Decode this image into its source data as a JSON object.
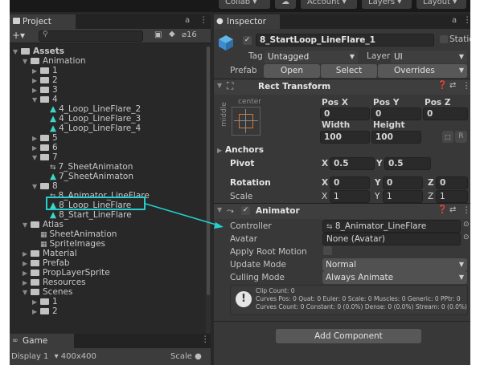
{
  "toolbar": {
    "collab": "Collab",
    "account": "Account",
    "layers": "Layers",
    "layout": "Layout"
  },
  "project": {
    "tab": "Project",
    "hidden_count": "16",
    "tree": [
      {
        "label": "Assets",
        "kind": "folder-open",
        "depth": 0,
        "bold": true
      },
      {
        "label": "Animation",
        "kind": "folder-open",
        "depth": 1
      },
      {
        "label": "1",
        "kind": "folder",
        "depth": 2
      },
      {
        "label": "2",
        "kind": "folder",
        "depth": 2
      },
      {
        "label": "3",
        "kind": "folder",
        "depth": 2
      },
      {
        "label": "4",
        "kind": "folder-open",
        "depth": 2
      },
      {
        "label": "4_Loop_LineFlare_2",
        "kind": "sprite",
        "depth": 3
      },
      {
        "label": "4_Loop_LineFlare_3",
        "kind": "sprite",
        "depth": 3
      },
      {
        "label": "4_Loop_LineFlare_4",
        "kind": "sprite",
        "depth": 3
      },
      {
        "label": "5",
        "kind": "folder",
        "depth": 2
      },
      {
        "label": "6",
        "kind": "folder",
        "depth": 2
      },
      {
        "label": "7",
        "kind": "folder-open",
        "depth": 2
      },
      {
        "label": "7_SheetAnimaton",
        "kind": "animator",
        "depth": 3
      },
      {
        "label": "7_SheetAnimaton",
        "kind": "sprite",
        "depth": 3
      },
      {
        "label": "8",
        "kind": "folder-open",
        "depth": 2
      },
      {
        "label": "8_Animator_LineFlare",
        "kind": "animator",
        "depth": 3
      },
      {
        "label": "8_Loop_LineFlare",
        "kind": "sprite",
        "depth": 3
      },
      {
        "label": "8_Start_LineFlare",
        "kind": "sprite",
        "depth": 3
      },
      {
        "label": "Atlas",
        "kind": "folder-open",
        "depth": 1
      },
      {
        "label": "SheetAnimation",
        "kind": "atlas",
        "depth": 2
      },
      {
        "label": "SpriteImages",
        "kind": "atlas",
        "depth": 2
      },
      {
        "label": "Material",
        "kind": "folder",
        "depth": 1
      },
      {
        "label": "Prefab",
        "kind": "folder",
        "depth": 1
      },
      {
        "label": "PropLayerSprite",
        "kind": "folder",
        "depth": 1
      },
      {
        "label": "Resources",
        "kind": "folder",
        "depth": 1
      },
      {
        "label": "Scenes",
        "kind": "folder-open",
        "depth": 1
      },
      {
        "label": "1",
        "kind": "folder",
        "depth": 2
      },
      {
        "label": "2",
        "kind": "folder",
        "depth": 2
      }
    ]
  },
  "game": {
    "tab": "Game",
    "display": "Display 1",
    "resolution": "400x400",
    "scale": "Scale"
  },
  "inspector": {
    "tab": "Inspector",
    "object_name": "8_StartLoop_LineFlare_1",
    "static": "Static",
    "tag_label": "Tag",
    "tag_value": "Untagged",
    "layer_label": "Layer",
    "layer_value": "UI",
    "prefab_label": "Prefab",
    "prefab_open": "Open",
    "prefab_select": "Select",
    "prefab_overrides": "Overrides",
    "rect_transform": {
      "title": "Rect Transform",
      "anchor_h": "center",
      "anchor_v": "middle",
      "pos_x_label": "Pos X",
      "pos_y_label": "Pos Y",
      "pos_z_label": "Pos Z",
      "pos_x": "0",
      "pos_y": "0",
      "pos_z": "0",
      "width_label": "Width",
      "height_label": "Height",
      "width": "100",
      "height": "100",
      "r_button": "R",
      "anchors": "Anchors",
      "pivot_label": "Pivot",
      "pivot_x": "0.5",
      "pivot_y": "0.5",
      "rotation_label": "Rotation",
      "rot_x": "0",
      "rot_y": "0",
      "rot_z": "0",
      "scale_label": "Scale",
      "scale_x": "1",
      "scale_y": "1",
      "scale_z": "1",
      "x": "X",
      "y": "Y",
      "z": "Z"
    },
    "animator": {
      "title": "Animator",
      "controller_label": "Controller",
      "controller_value": "8_Animator_LineFlare",
      "avatar_label": "Avatar",
      "avatar_value": "None (Avatar)",
      "root_motion_label": "Apply Root Motion",
      "update_mode_label": "Update Mode",
      "update_mode_value": "Normal",
      "culling_mode_label": "Culling Mode",
      "culling_mode_value": "Always Animate",
      "info_line1": "Clip Count: 0",
      "info_line2": "Curves Pos: 0 Quat: 0 Euler: 0 Scale: 0 Muscles: 0 Generic: 0 PPtr: 0",
      "info_line3": "Curves Count: 0 Constant: 0 (0.0%) Dense: 0 (0.0%) Stream: 0 (0.0%)"
    },
    "add_component": "Add Component"
  },
  "colors": {
    "annotation": "#22d1cf",
    "panel": "#383838",
    "sprite_icon": "#3fd6c6"
  }
}
